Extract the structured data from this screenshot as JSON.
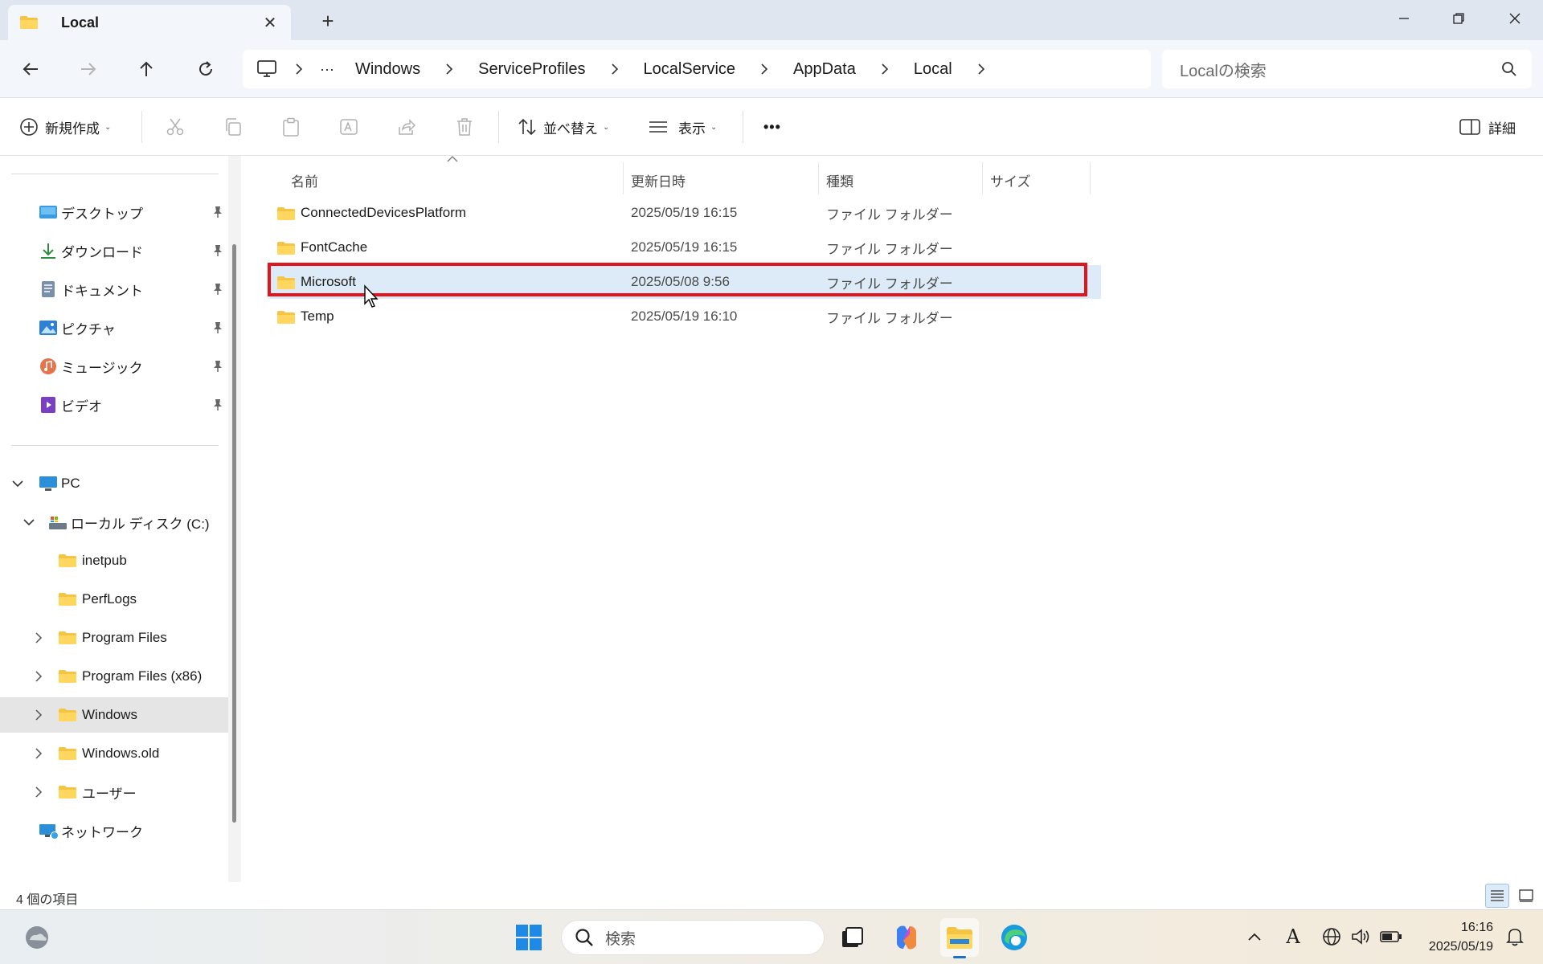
{
  "window": {
    "tab_title": "Local",
    "tab_close": "✕",
    "new_tab": "+"
  },
  "address": {
    "overflow": "···",
    "crumbs": [
      "Windows",
      "ServiceProfiles",
      "LocalService",
      "AppData",
      "Local"
    ],
    "search_placeholder": "Localの検索"
  },
  "toolbar": {
    "new_label": "新規作成",
    "sort_label": "並べ替え",
    "view_label": "表示",
    "more_label": "•••",
    "details_label": "詳細"
  },
  "sidebar": {
    "quick": [
      {
        "label": "デスクトップ",
        "icon": "desktop-icon"
      },
      {
        "label": "ダウンロード",
        "icon": "download-icon"
      },
      {
        "label": "ドキュメント",
        "icon": "document-icon"
      },
      {
        "label": "ピクチャ",
        "icon": "picture-icon"
      },
      {
        "label": "ミュージック",
        "icon": "music-icon"
      },
      {
        "label": "ビデオ",
        "icon": "video-icon"
      }
    ],
    "pc_label": "PC",
    "drive_label": "ローカル ディスク (C:)",
    "folders": [
      {
        "label": "inetpub",
        "expandable": false
      },
      {
        "label": "PerfLogs",
        "expandable": false
      },
      {
        "label": "Program Files",
        "expandable": true
      },
      {
        "label": "Program Files (x86)",
        "expandable": true
      },
      {
        "label": "Windows",
        "expandable": true,
        "selected": true
      },
      {
        "label": "Windows.old",
        "expandable": true
      },
      {
        "label": "ユーザー",
        "expandable": true
      }
    ],
    "network_label": "ネットワーク"
  },
  "columns": {
    "name": "名前",
    "date": "更新日時",
    "type": "種類",
    "size": "サイズ"
  },
  "files": [
    {
      "name": "ConnectedDevicesPlatform",
      "date": "2025/05/19 16:15",
      "type": "ファイル フォルダー",
      "selected": false
    },
    {
      "name": "FontCache",
      "date": "2025/05/19 16:15",
      "type": "ファイル フォルダー",
      "selected": false
    },
    {
      "name": "Microsoft",
      "date": "2025/05/08 9:56",
      "type": "ファイル フォルダー",
      "selected": true
    },
    {
      "name": "Temp",
      "date": "2025/05/19 16:10",
      "type": "ファイル フォルダー",
      "selected": false
    }
  ],
  "status": {
    "item_count": "4 個の項目"
  },
  "taskbar": {
    "search_label": "検索",
    "time": "16:16",
    "date": "2025/05/19",
    "ime_label": "A"
  },
  "colors": {
    "highlight_border": "#e3141b",
    "selection": "#dcebf7",
    "folder": "#f6c445"
  }
}
